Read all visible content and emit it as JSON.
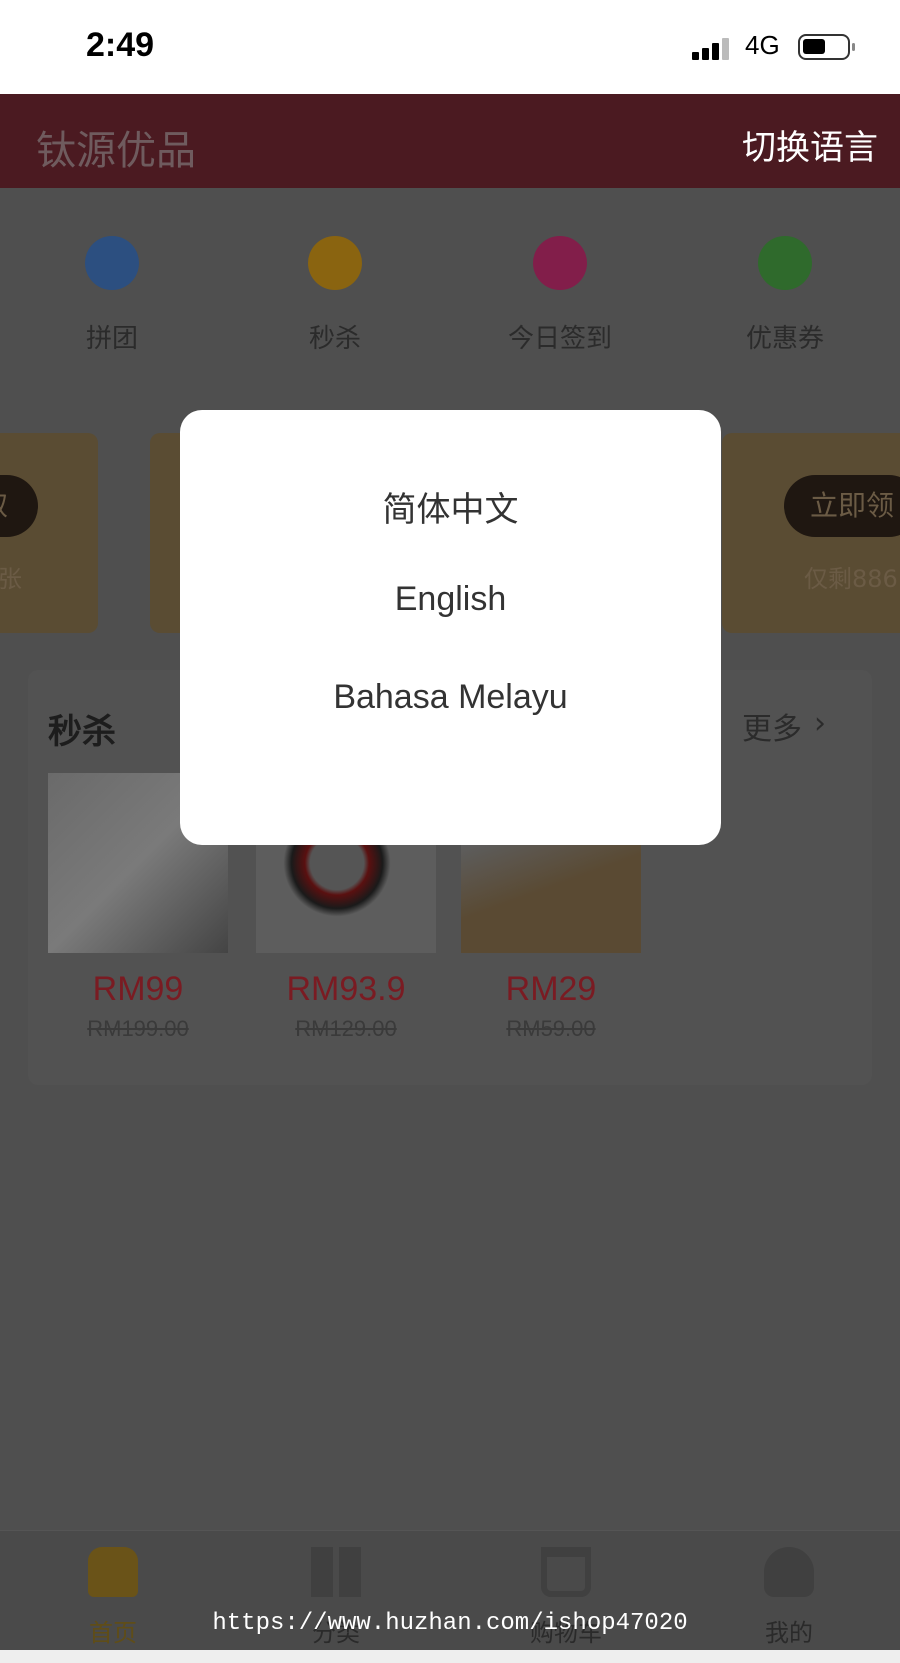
{
  "status_bar": {
    "time": "2:49",
    "network": "4G",
    "battery_level": 0.5
  },
  "header": {
    "title": "钛源优品",
    "switch_language": "切换语言",
    "color": "#4b1a21"
  },
  "quick_links": [
    {
      "label": "拼团",
      "icon": "gift-icon",
      "color": "#2c4f80"
    },
    {
      "label": "秒杀",
      "icon": "alarm-clock-icon",
      "color": "#8a6410"
    },
    {
      "label": "今日签到",
      "icon": "calendar-check-icon",
      "color": "#821e4a"
    },
    {
      "label": "优惠券",
      "icon": "carrot-tag-icon",
      "color": "#2f6a2c"
    }
  ],
  "coupons": {
    "left_button": "取",
    "left_text": "张",
    "right_button": "立即领",
    "right_text": "仅剩886"
  },
  "flash_sale": {
    "title": "秒杀",
    "more": "更多",
    "products": [
      {
        "price": "RM99",
        "original_price": "RM199.00"
      },
      {
        "price": "RM93.9",
        "original_price": "RM129.00"
      },
      {
        "price": "RM29",
        "original_price": "RM59.00"
      }
    ]
  },
  "language_dialog": {
    "options": [
      "简体中文",
      "English",
      "Bahasa Melayu"
    ]
  },
  "bottom_nav": [
    {
      "label": "首页",
      "icon": "home-icon",
      "active": true
    },
    {
      "label": "分类",
      "icon": "grid-icon"
    },
    {
      "label": "购物车",
      "icon": "cart-icon"
    },
    {
      "label": "我的",
      "icon": "user-icon"
    }
  ],
  "watermark": "https://www.huzhan.com/ishop47020"
}
